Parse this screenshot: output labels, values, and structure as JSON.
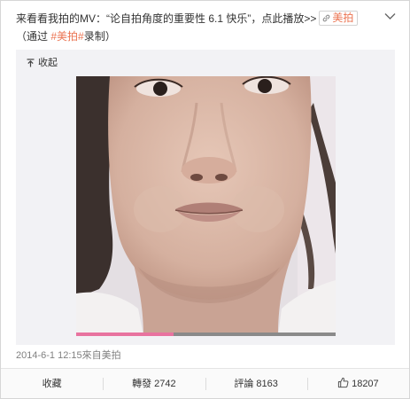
{
  "post": {
    "text_prefix": "来看看我拍的MV：“论自拍角度的重要性 6.1 快乐”，点此播放>>",
    "link_label": "美拍",
    "via_prefix": "（通过 ",
    "hashtag": "#美拍#",
    "via_suffix": "录制）"
  },
  "media": {
    "collapse_label": "收起",
    "progress": 0.375
  },
  "meta": {
    "timestamp": "2014-6-1 12:15",
    "source_prefix": "來自",
    "source": "美拍"
  },
  "actions": [
    {
      "label": "收藏"
    },
    {
      "label": "轉發",
      "count": "2742"
    },
    {
      "label": "評論",
      "count": "8163"
    },
    {
      "icon": "thumbs-up-icon",
      "count": "18207"
    }
  ],
  "icons": {
    "menu": "chevron-down-icon",
    "link": "link-icon",
    "collapse": "collapse-up-icon",
    "like": "thumbs-up-icon"
  },
  "colors": {
    "accent": "#eb7350",
    "progress": "#e8739f",
    "media_background": "#f2f2f5",
    "muted_text": "#808080"
  }
}
